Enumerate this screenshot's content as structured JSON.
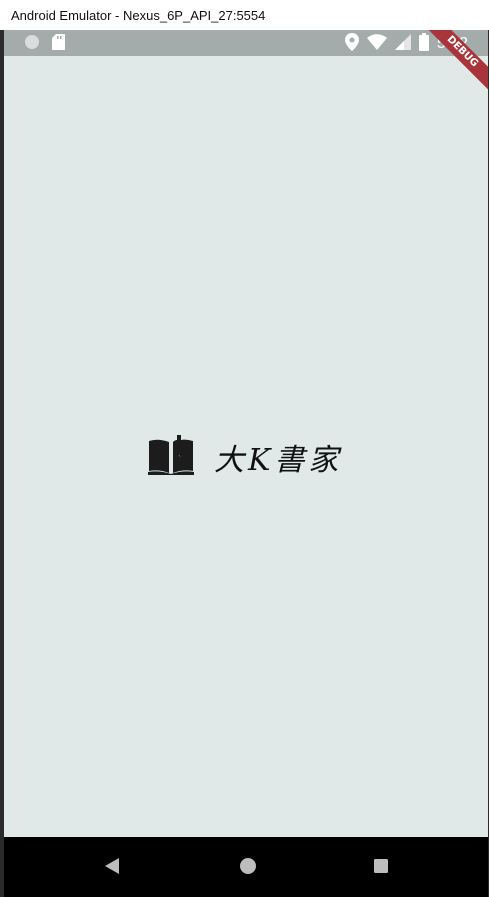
{
  "window": {
    "title": "Android Emulator - Nexus_6P_API_27:5554"
  },
  "status_bar": {
    "time": "5:22",
    "left_icons": [
      "circle-icon",
      "sd-card-icon"
    ],
    "right_icons": [
      "location-icon",
      "wifi-icon",
      "cellular-icon",
      "battery-icon"
    ]
  },
  "app": {
    "background_color": "#e0e9e8",
    "logo_text": "大K書家",
    "logo_icon": "book-open-icon"
  },
  "debug_banner": {
    "label": "DEBUG",
    "color": "#a8353b"
  },
  "nav_bar": {
    "buttons": [
      "back-icon",
      "home-icon",
      "recents-icon"
    ]
  }
}
